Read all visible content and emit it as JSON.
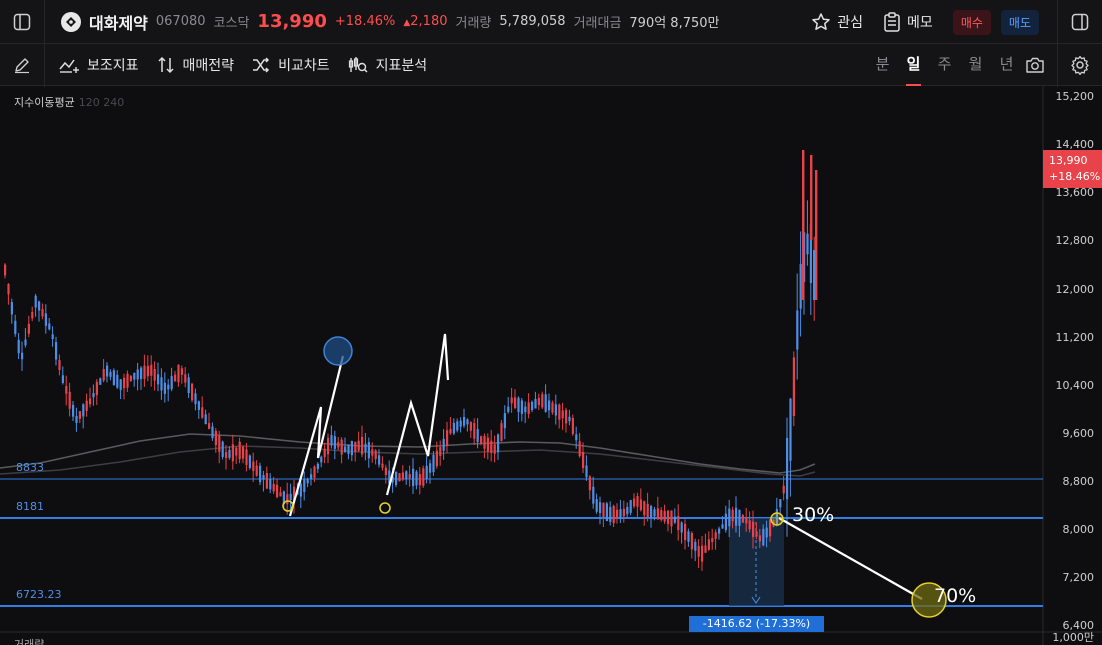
{
  "header": {
    "stock_name": "대화제약",
    "stock_code": "067080",
    "market": "코스닥",
    "price": "13,990",
    "change_pct": "+18.46%",
    "change_abs": "2,180",
    "volume_label": "거래량",
    "volume_value": "5,789,058",
    "amount_label": "거래대금",
    "amount_value": "790억 8,750만",
    "watch_label": "관심",
    "memo_label": "메모",
    "buy_label": "매수",
    "sell_label": "매도"
  },
  "toolbar": {
    "indicator_label": "보조지표",
    "strategy_label": "매매전략",
    "compare_label": "비교차트",
    "analysis_label": "지표분석",
    "periods": [
      "분",
      "일",
      "주",
      "월",
      "년"
    ],
    "active_period": "일"
  },
  "chart": {
    "ma_legend": "지수이동평균",
    "ma_periods": "120 240",
    "y_ticks": [
      "15,200",
      "14,400",
      "13,600",
      "12,800",
      "12,000",
      "11,200",
      "10,400",
      "9,600",
      "8,800",
      "8,000",
      "7,200",
      "6,400"
    ],
    "price_tag_value": "13,990",
    "price_tag_change": "+18.46%",
    "levels": [
      "8833",
      "8181",
      "6723.23"
    ],
    "measure_label": "-1416.62 (-17.33%)",
    "ratio_30": "30%",
    "ratio_70": "70%",
    "volume_label": "거래량",
    "volume_tick": "1,000만",
    "colors": {
      "up": "#e8424a",
      "down": "#4e8fe6",
      "level": "#2f7fe8",
      "highlight": "#e6d12a"
    }
  }
}
